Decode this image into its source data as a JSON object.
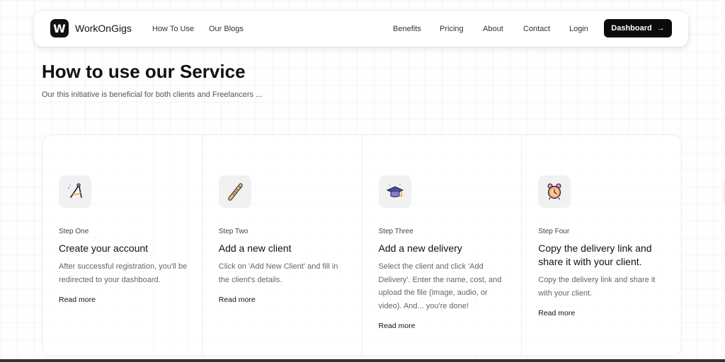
{
  "nav": {
    "logo_letter": "W",
    "brand": "WorkOnGigs",
    "left_links": [
      "How To Use",
      "Our Blogs"
    ],
    "right_links": [
      "Benefits",
      "Pricing",
      "About",
      "Contact",
      "Login"
    ],
    "dashboard_label": "Dashboard",
    "dashboard_arrow": "→"
  },
  "hero": {
    "title": "How to use our Service",
    "subtitle": "Our this initiative is beneficial for both clients and Freelancers ..."
  },
  "steps": [
    {
      "icon": "compass-icon",
      "label": "Step One",
      "title": "Create your account",
      "description": "After successful registration, you'll be redirected to your dashboard.",
      "link": "Read more"
    },
    {
      "icon": "flute-icon",
      "label": "Step Two",
      "title": "Add a new client",
      "description": "Click on 'Add New Client' and fill in the client's details.",
      "link": "Read more"
    },
    {
      "icon": "graduation-cap-icon",
      "label": "Step Three",
      "title": "Add a new delivery",
      "description": "Select the client and click 'Add Delivery'. Enter the name, cost, and upload the file (image, audio, or video). And... you're done!",
      "link": "Read more"
    },
    {
      "icon": "alarm-clock-icon",
      "label": "Step Four",
      "title": "Copy the delivery link and share it with your client.",
      "description": "Copy the delivery link and share it with your client.",
      "link": "Read more"
    }
  ],
  "colors": {
    "primary": "#0b0b0b",
    "text_muted": "#666666",
    "icon_bg": "#f1f1f1"
  }
}
